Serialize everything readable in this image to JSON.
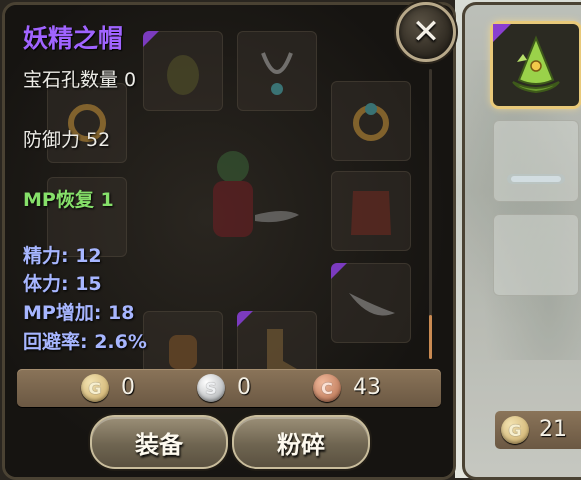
{
  "item": {
    "name": "妖精之帽",
    "gem_slots": "宝石孔数量 0",
    "defense": "防御力 52",
    "mp_recovery": "MP恢复 1",
    "spirit": "精力: 12",
    "stamina": "体力: 15",
    "mp_increase": "MP增加: 18",
    "evasion": "回避率: 2.6%"
  },
  "currency": {
    "gold": {
      "icon_letter": "G",
      "amount": "0"
    },
    "silver": {
      "icon_letter": "S",
      "amount": "0"
    },
    "copper": {
      "icon_letter": "C",
      "amount": "43"
    }
  },
  "buttons": {
    "equip": "装备",
    "smash": "粉碎",
    "close": "✕"
  },
  "inventory": {
    "coin_icon_letter": "G",
    "coin_amount": "21"
  },
  "colors": {
    "item_name": "#a064ff",
    "green_stat": "#86e06a",
    "blue_stat": "#a7b6ff",
    "rarity_corner": "#7b3bbf",
    "selected_glow": "#e8c97a"
  },
  "icons": [
    "close-icon",
    "gold-coin-icon",
    "silver-coin-icon",
    "copper-coin-icon",
    "fairy-hat-icon",
    "character-avatar",
    "necklace-icon",
    "ring-icon",
    "armor-icon",
    "weapon-icon",
    "gloves-icon",
    "boots-icon"
  ]
}
